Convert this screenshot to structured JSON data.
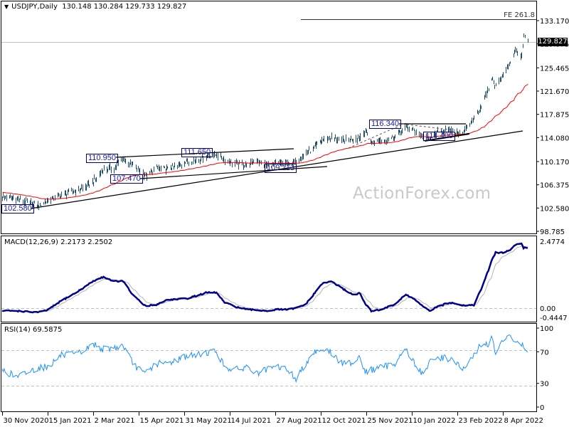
{
  "header": {
    "symbol_label": "USDJPY,Daily",
    "ohlc": "130.148 130.284 129.733 129.827"
  },
  "watermark": "ActionForex.com",
  "colors": {
    "bars": "#1f4e6e",
    "moving_average": "#ff0000",
    "trendlines": "#000000",
    "macd": "#00008b",
    "macd_signal": "#b4b4b4",
    "rsi": "#1e90ff",
    "label_border": "#00007a"
  },
  "x_axis": {
    "ticks": [
      "30 Nov 2020",
      "15 Jan 2021",
      "2 Mar 2021",
      "15 Apr 2021",
      "31 May 2021",
      "14 Jul 2021",
      "27 Aug 2021",
      "12 Oct 2021",
      "25 Nov 2021",
      "10 Jan 2022",
      "23 Feb 2022",
      "8 Apr 2022"
    ]
  },
  "chart_data": [
    {
      "type": "ohlc",
      "title": "USDJPY,Daily",
      "ohlc_last": {
        "open": 130.148,
        "high": 130.284,
        "low": 129.733,
        "close": 129.827
      },
      "ylim": [
        98.785,
        133.17
      ],
      "y_ticks": [
        "133.170",
        "129.375",
        "125.465",
        "121.670",
        "117.875",
        "114.080",
        "110.170",
        "106.375",
        "102.580",
        "98.785"
      ],
      "current_price": "129.827",
      "dates": [
        "2020-11-30",
        "2020-12-15",
        "2020-12-31",
        "2021-01-06",
        "2021-01-15",
        "2021-01-29",
        "2021-02-12",
        "2021-02-22",
        "2021-03-02",
        "2021-03-12",
        "2021-03-22",
        "2021-03-31",
        "2021-04-09",
        "2021-04-20",
        "2021-04-23",
        "2021-05-03",
        "2021-05-13",
        "2021-05-24",
        "2021-06-02",
        "2021-06-11",
        "2021-06-21",
        "2021-07-01",
        "2021-07-09",
        "2021-07-20",
        "2021-07-30",
        "2021-08-09",
        "2021-08-19",
        "2021-08-30",
        "2021-09-09",
        "2021-09-17",
        "2021-09-27",
        "2021-10-04",
        "2021-10-13",
        "2021-10-22",
        "2021-11-01",
        "2021-11-12",
        "2021-11-19",
        "2021-11-24",
        "2021-11-30",
        "2021-12-08",
        "2021-12-16",
        "2021-12-24",
        "2022-01-04",
        "2022-01-12",
        "2022-01-20",
        "2022-01-27",
        "2022-02-04",
        "2022-02-11",
        "2022-02-18",
        "2022-03-01",
        "2022-03-11",
        "2022-03-18",
        "2022-03-25",
        "2022-03-28",
        "2022-04-01",
        "2022-04-08",
        "2022-04-15",
        "2022-04-20",
        "2022-04-26",
        "2022-04-28",
        "2022-05-02"
      ],
      "close": [
        104.4,
        104.0,
        103.2,
        102.9,
        103.8,
        104.7,
        105.4,
        106.0,
        106.9,
        108.9,
        109.1,
        110.6,
        109.6,
        108.1,
        107.8,
        109.1,
        108.9,
        109.4,
        110.1,
        110.4,
        111.0,
        111.3,
        110.4,
        109.8,
        109.6,
        110.3,
        109.5,
        109.8,
        109.8,
        110.1,
        111.6,
        112.1,
        113.7,
        114.1,
        113.5,
        113.9,
        114.2,
        115.2,
        113.1,
        113.6,
        113.7,
        114.4,
        115.8,
        115.3,
        114.2,
        113.9,
        114.9,
        115.4,
        115.0,
        114.9,
        117.3,
        119.2,
        122.0,
        123.8,
        122.5,
        124.3,
        126.4,
        128.3,
        127.2,
        130.5,
        129.827
      ],
      "annotations": {
        "labels": [
          "102.580",
          "110.950",
          "111.650",
          "107.470",
          "109.113",
          "116.340",
          "114.400"
        ],
        "fe_label": "FE 261.8"
      }
    },
    {
      "type": "line",
      "title": "MACD(12,26,9) 2.2173 2.2502",
      "y_ticks": [
        "2.4774",
        "0.00",
        "-0.4447"
      ],
      "ylim": [
        -0.4447,
        2.4774
      ],
      "dates": [
        "2020-11-30",
        "2020-12-15",
        "2020-12-31",
        "2021-01-06",
        "2021-01-15",
        "2021-01-29",
        "2021-02-12",
        "2021-02-22",
        "2021-03-02",
        "2021-03-12",
        "2021-03-22",
        "2021-03-31",
        "2021-04-09",
        "2021-04-20",
        "2021-04-23",
        "2021-05-03",
        "2021-05-13",
        "2021-05-24",
        "2021-06-02",
        "2021-06-11",
        "2021-06-21",
        "2021-07-01",
        "2021-07-09",
        "2021-07-20",
        "2021-07-30",
        "2021-08-09",
        "2021-08-19",
        "2021-08-30",
        "2021-09-09",
        "2021-09-17",
        "2021-09-27",
        "2021-10-04",
        "2021-10-13",
        "2021-10-22",
        "2021-11-01",
        "2021-11-12",
        "2021-11-19",
        "2021-11-24",
        "2021-11-30",
        "2021-12-08",
        "2021-12-16",
        "2021-12-24",
        "2022-01-04",
        "2022-01-12",
        "2022-01-20",
        "2022-01-27",
        "2022-02-04",
        "2022-02-11",
        "2022-02-18",
        "2022-03-01",
        "2022-03-11",
        "2022-03-18",
        "2022-03-25",
        "2022-03-28",
        "2022-04-01",
        "2022-04-08",
        "2022-04-15",
        "2022-04-20",
        "2022-04-26",
        "2022-04-28",
        "2022-05-02"
      ],
      "macd": [
        -0.1,
        -0.1,
        -0.15,
        -0.15,
        -0.07,
        0.28,
        0.56,
        0.8,
        1.0,
        1.16,
        1.0,
        1.0,
        0.5,
        0.12,
        0.08,
        0.13,
        0.3,
        0.34,
        0.35,
        0.45,
        0.57,
        0.58,
        0.21,
        0.05,
        -0.05,
        -0.07,
        -0.1,
        -0.05,
        -0.05,
        0.0,
        0.15,
        0.47,
        0.9,
        1.0,
        0.75,
        0.5,
        0.55,
        0.15,
        -0.1,
        -0.07,
        0.03,
        0.15,
        0.5,
        0.35,
        0.08,
        -0.1,
        0.05,
        0.15,
        0.21,
        0.1,
        0.12,
        0.7,
        1.4,
        1.75,
        2.06,
        2.06,
        2.15,
        2.35,
        2.4,
        2.24,
        2.2173
      ]
    },
    {
      "type": "line",
      "title": "RSI(14) 69.5875",
      "y_ticks": [
        "100",
        "70",
        "30",
        "0"
      ],
      "ylim": [
        0,
        100
      ],
      "levels": [
        70,
        30
      ],
      "dates": [
        "2020-11-30",
        "2020-12-15",
        "2020-12-31",
        "2021-01-06",
        "2021-01-15",
        "2021-01-29",
        "2021-02-12",
        "2021-02-22",
        "2021-03-02",
        "2021-03-12",
        "2021-03-22",
        "2021-03-31",
        "2021-04-09",
        "2021-04-20",
        "2021-04-23",
        "2021-05-03",
        "2021-05-13",
        "2021-05-24",
        "2021-06-02",
        "2021-06-11",
        "2021-06-21",
        "2021-07-01",
        "2021-07-09",
        "2021-07-20",
        "2021-07-30",
        "2021-08-09",
        "2021-08-19",
        "2021-08-30",
        "2021-09-09",
        "2021-09-17",
        "2021-09-27",
        "2021-10-04",
        "2021-10-13",
        "2021-10-22",
        "2021-11-01",
        "2021-11-12",
        "2021-11-19",
        "2021-11-24",
        "2021-11-30",
        "2021-12-08",
        "2021-12-16",
        "2021-12-24",
        "2022-01-04",
        "2022-01-12",
        "2022-01-20",
        "2022-01-27",
        "2022-02-04",
        "2022-02-11",
        "2022-02-18",
        "2022-03-01",
        "2022-03-11",
        "2022-03-18",
        "2022-03-25",
        "2022-03-28",
        "2022-04-01",
        "2022-04-08",
        "2022-04-15",
        "2022-04-20",
        "2022-04-26",
        "2022-04-28",
        "2022-05-02"
      ],
      "values": [
        47,
        38,
        47,
        50,
        51,
        66,
        66,
        72,
        80,
        73,
        75,
        78,
        56,
        42,
        45,
        55,
        55,
        60,
        65,
        65,
        69,
        71,
        51,
        47,
        51,
        42,
        47,
        51,
        47,
        35,
        56,
        69,
        74,
        69,
        55,
        57,
        65,
        44,
        47,
        50,
        52,
        56,
        74,
        56,
        42,
        56,
        62,
        63,
        60,
        47,
        65,
        80,
        80,
        87,
        69,
        83,
        90,
        83,
        80,
        75,
        69.5875
      ]
    }
  ]
}
